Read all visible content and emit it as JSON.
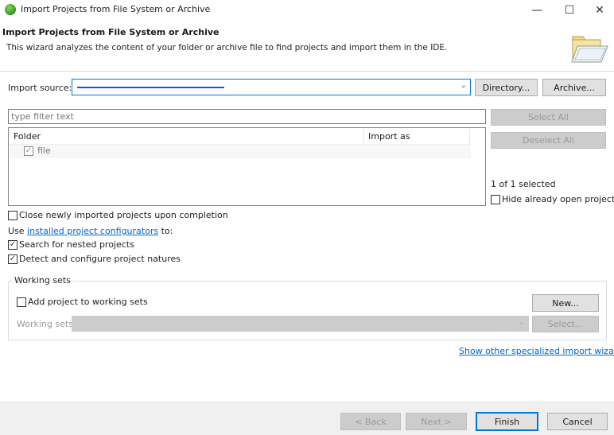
{
  "window": {
    "title": "Import Projects from File System or Archive",
    "controls": {
      "minimize": "—",
      "maximize": "☐",
      "close": "✕"
    }
  },
  "header": {
    "title": "Import Projects from File System or Archive",
    "description": "This wizard analyzes the content of your folder or archive file to find projects and import them in the IDE."
  },
  "source": {
    "label": "Import source:",
    "value": "",
    "directory_button": "Directory...",
    "archive_button": "Archive..."
  },
  "filter": {
    "placeholder": "type filter text",
    "select_all": "Select All",
    "deselect_all": "Deselect All"
  },
  "table": {
    "columns": [
      "Folder",
      "Import as"
    ],
    "rows": [
      {
        "folder": "file",
        "import_as": "",
        "checked": true
      }
    ]
  },
  "selection": {
    "count_text": "1 of 1 selected",
    "hide_open_label": "Hide already open projects",
    "hide_open_checked": false
  },
  "options": {
    "close_imported": {
      "label": "Close newly imported projects upon completion",
      "checked": false
    },
    "use_prefix": "Use ",
    "use_link": "installed project configurators",
    "use_suffix": " to:",
    "search_nested": {
      "label": "Search for nested projects",
      "checked": true
    },
    "detect_natures": {
      "label": "Detect and configure project natures",
      "checked": true
    }
  },
  "working_sets": {
    "group_title": "Working sets",
    "add_label": "Add project to working sets",
    "add_checked": false,
    "new_button": "New...",
    "sets_label": "Working sets:",
    "select_button": "Select..."
  },
  "other_wizards_link": "Show other specialized import wizards",
  "footer": {
    "back": "< Back",
    "next": "Next >",
    "finish": "Finish",
    "cancel": "Cancel"
  },
  "colors": {
    "accent": "#0078d7",
    "link": "#0066cc",
    "disabled": "#cccccc"
  }
}
